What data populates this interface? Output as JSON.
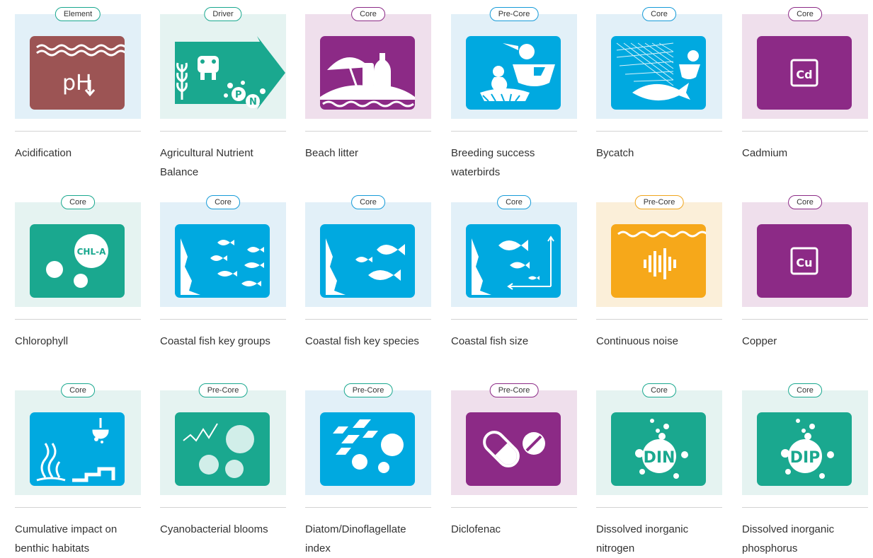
{
  "colors": {
    "element": "#9c5454",
    "core_purple": "#8c2a86",
    "teal": "#1aa88f",
    "blue": "#00a9e0",
    "orange": "#f6a81a"
  },
  "cards": [
    {
      "badge": "Element",
      "title": "Acidification",
      "icon": "acidification-icon"
    },
    {
      "badge": "Driver",
      "title": "Agricultural Nutrient Balance",
      "icon": "agricultural-nutrient-icon"
    },
    {
      "badge": "Core",
      "title": "Beach litter",
      "icon": "beach-litter-icon"
    },
    {
      "badge": "Pre-Core",
      "title": "Breeding success waterbirds",
      "icon": "waterbirds-icon"
    },
    {
      "badge": "Core",
      "title": "Bycatch",
      "icon": "bycatch-icon"
    },
    {
      "badge": "Core",
      "title": "Cadmium",
      "icon": "cadmium-icon",
      "tile_text": "Cd"
    },
    {
      "badge": "Core",
      "title": "Chlorophyll",
      "icon": "chlorophyll-icon",
      "tile_text": "CHL-A"
    },
    {
      "badge": "Core",
      "title": "Coastal fish key groups",
      "icon": "fish-groups-icon"
    },
    {
      "badge": "Core",
      "title": "Coastal fish key species",
      "icon": "fish-species-icon"
    },
    {
      "badge": "Core",
      "title": "Coastal fish size",
      "icon": "fish-size-icon"
    },
    {
      "badge": "Pre-Core",
      "title": "Continuous noise",
      "icon": "noise-icon"
    },
    {
      "badge": "Core",
      "title": "Copper",
      "icon": "copper-icon",
      "tile_text": "Cu"
    },
    {
      "badge": "Core",
      "title": "Cumulative impact on benthic habitats",
      "icon": "benthic-habitats-icon"
    },
    {
      "badge": "Pre-Core",
      "title": "Cyanobacterial blooms",
      "icon": "cyanobacteria-icon"
    },
    {
      "badge": "Pre-Core",
      "title": "Diatom/Dinoflagellate index",
      "icon": "diatom-icon"
    },
    {
      "badge": "Pre-Core",
      "title": "Diclofenac",
      "icon": "pill-icon"
    },
    {
      "badge": "Core",
      "title": "Dissolved inorganic nitrogen",
      "icon": "din-icon",
      "tile_text": "DIN"
    },
    {
      "badge": "Core",
      "title": "Dissolved inorganic phosphorus",
      "icon": "dip-icon",
      "tile_text": "DIP"
    }
  ],
  "acid_text": "pH",
  "nutrient_labels": [
    "P",
    "N"
  ]
}
